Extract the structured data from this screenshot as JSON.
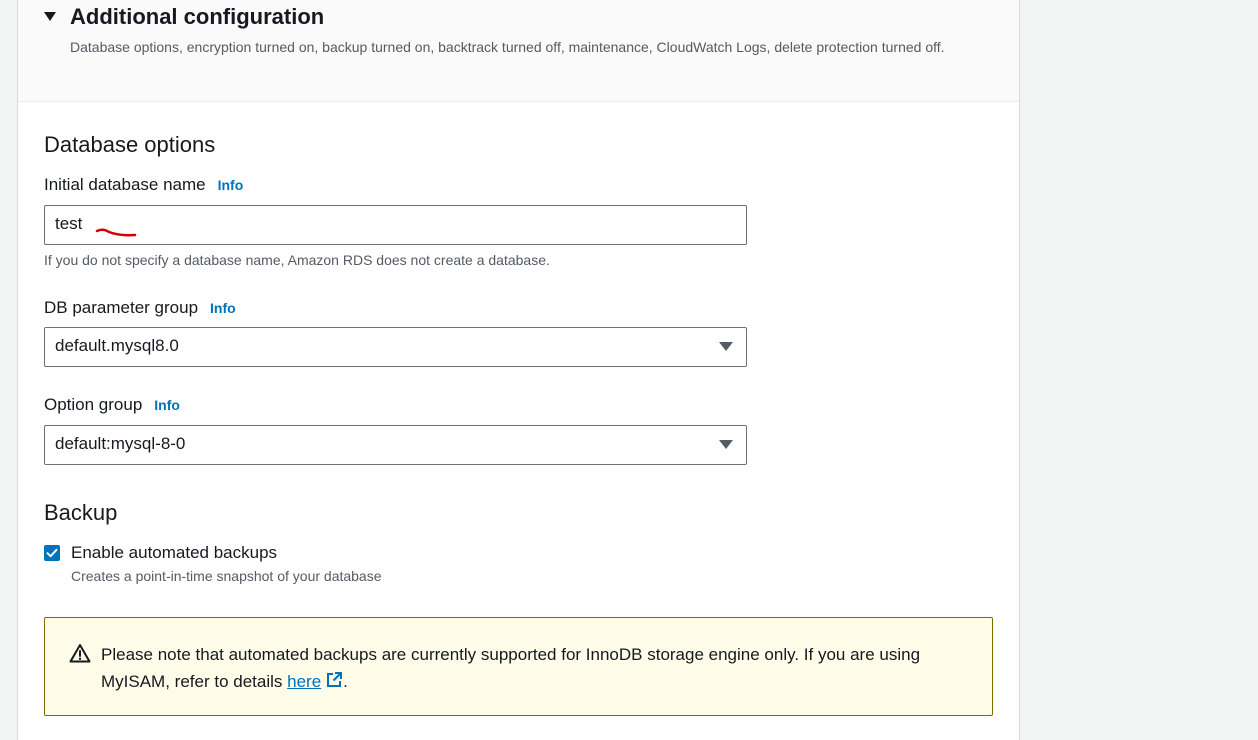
{
  "header": {
    "title": "Additional configuration",
    "description": "Database options, encryption turned on, backup turned on, backtrack turned off, maintenance, CloudWatch Logs, delete protection turned off."
  },
  "database_options": {
    "title": "Database options",
    "initial_db_name": {
      "label": "Initial database name",
      "info": "Info",
      "value": "test",
      "hint": "If you do not specify a database name, Amazon RDS does not create a database."
    },
    "parameter_group": {
      "label": "DB parameter group",
      "info": "Info",
      "value": "default.mysql8.0"
    },
    "option_group": {
      "label": "Option group",
      "info": "Info",
      "value": "default:mysql-8-0"
    }
  },
  "backup": {
    "title": "Backup",
    "enable_label": "Enable automated backups",
    "enable_checked": true,
    "enable_desc": "Creates a point-in-time snapshot of your database",
    "alert": {
      "text_before": "Please note that automated backups are currently supported for InnoDB storage engine only. If you are using MyISAM, refer to details ",
      "link_text": "here",
      "text_after": "."
    }
  },
  "colors": {
    "link": "#0073bb",
    "alert_bg": "#fffce9",
    "alert_border": "#7d6b00",
    "checkbox": "#0073bb",
    "annotation": "#d40000"
  },
  "icons": [
    "caret-down-icon",
    "select-arrow-icon",
    "checkmark-icon",
    "warning-icon",
    "external-link-icon"
  ]
}
